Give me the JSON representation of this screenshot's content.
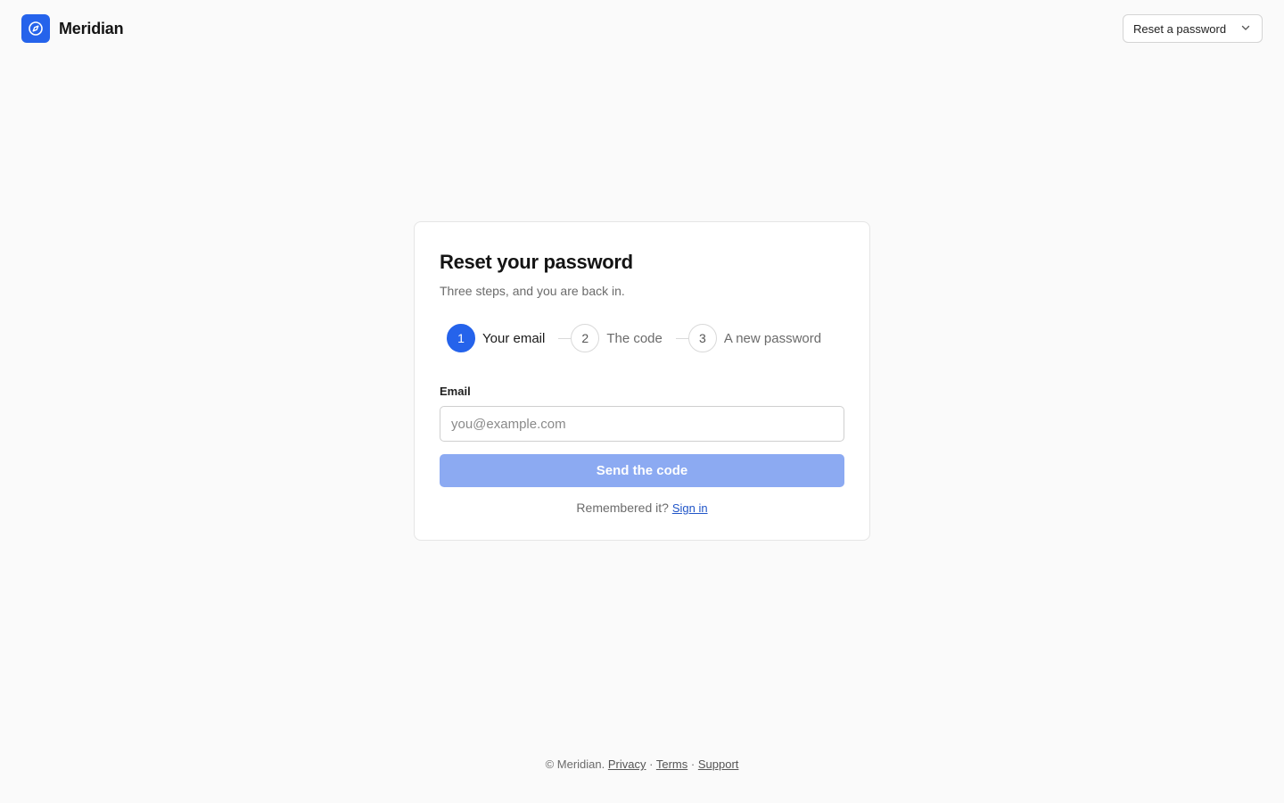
{
  "header": {
    "brand_name": "Meridian",
    "brand_icon": "compass-icon",
    "flow_select": {
      "selected": "Reset a password",
      "icon": "chevron-down-icon"
    }
  },
  "card": {
    "title": "Reset your password",
    "subtitle": "Three steps, and you are back in.",
    "steps": [
      {
        "number": "1",
        "label": "Your email",
        "active": true
      },
      {
        "number": "2",
        "label": "The code",
        "active": false
      },
      {
        "number": "3",
        "label": "A new password",
        "active": false
      }
    ],
    "email_label": "Email",
    "email_value": "",
    "email_placeholder": "you@example.com",
    "send_label": "Send the code",
    "remember_text": "Remembered it?",
    "signin_label": "Sign in"
  },
  "footer": {
    "copyright": "© Meridian.",
    "separator": "·",
    "links": [
      "Privacy",
      "Terms",
      "Support"
    ]
  },
  "colors": {
    "accent": "#2563eb",
    "button_disabled": "#8caaf2",
    "link": "#2055c8",
    "background": "#fafafa"
  }
}
